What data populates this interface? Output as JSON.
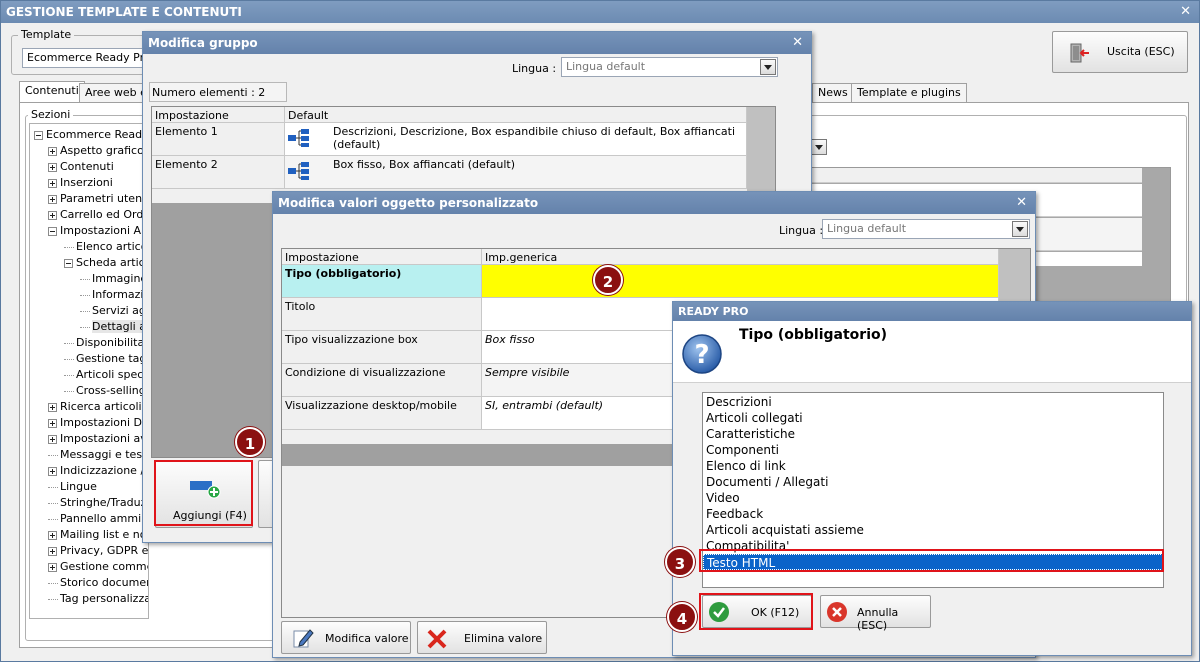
{
  "app": {
    "title": "GESTIONE TEMPLATE E CONTENUTI",
    "template_label": "Template",
    "template_value": "Ecommerce Ready Pro (",
    "exit_label": "Uscita (ESC)",
    "tabs": [
      "Contenuti",
      "Aree web e",
      "News",
      "Template e plugins"
    ],
    "sections_label": "Sezioni",
    "tree": [
      {
        "label": "Ecommerce Ready P",
        "level": 0,
        "box": "minus"
      },
      {
        "label": "Aspetto grafico",
        "level": 1,
        "box": "plus"
      },
      {
        "label": "Contenuti",
        "level": 1,
        "box": "plus"
      },
      {
        "label": "Inserzioni",
        "level": 1,
        "box": "plus"
      },
      {
        "label": "Parametri utente",
        "level": 1,
        "box": "plus"
      },
      {
        "label": "Carrello ed Ordin",
        "level": 1,
        "box": "plus"
      },
      {
        "label": "Impostazioni Arti",
        "level": 1,
        "box": "minus"
      },
      {
        "label": "Elenco articol",
        "level": 2,
        "box": ""
      },
      {
        "label": "Scheda artico",
        "level": 2,
        "box": "minus"
      },
      {
        "label": "Immagine",
        "level": 3,
        "box": ""
      },
      {
        "label": "Informazio",
        "level": 3,
        "box": ""
      },
      {
        "label": "Servizi agg",
        "level": 3,
        "box": ""
      },
      {
        "label": "Dettagli ar",
        "level": 3,
        "box": "",
        "selected": true
      },
      {
        "label": "Disponibilita' e",
        "level": 2,
        "box": ""
      },
      {
        "label": "Gestione tagli",
        "level": 2,
        "box": ""
      },
      {
        "label": "Articoli specia",
        "level": 2,
        "box": ""
      },
      {
        "label": "Cross-selling",
        "level": 2,
        "box": ""
      },
      {
        "label": "Ricerca articoli",
        "level": 1,
        "box": "plus"
      },
      {
        "label": "Impostazioni Doc",
        "level": 1,
        "box": "plus"
      },
      {
        "label": "Impostazioni ava",
        "level": 1,
        "box": "plus"
      },
      {
        "label": "Messaggi e testi",
        "level": 1,
        "box": ""
      },
      {
        "label": "Indicizzazione / S",
        "level": 1,
        "box": "plus"
      },
      {
        "label": "Lingue",
        "level": 1,
        "box": ""
      },
      {
        "label": "Stringhe/Traduzi",
        "level": 1,
        "box": ""
      },
      {
        "label": "Pannello amminis",
        "level": 1,
        "box": ""
      },
      {
        "label": "Mailing list e noti",
        "level": 1,
        "box": "plus"
      },
      {
        "label": "Privacy, GDPR e Cookie",
        "level": 1,
        "box": "plus"
      },
      {
        "label": "Gestione commenti",
        "level": 1,
        "box": "plus"
      },
      {
        "label": "Storico documenti",
        "level": 1,
        "box": ""
      },
      {
        "label": "Tag personalizzati",
        "level": 1,
        "box": ""
      }
    ]
  },
  "group_dialog": {
    "title": "Modifica gruppo",
    "lingua_label": "Lingua :",
    "lingua_value": "Lingua default",
    "count_text": "Numero elementi : 2",
    "col_setting": "Impostazione",
    "col_default": "Default",
    "rows": [
      {
        "name": "Elemento 1",
        "value": "Descrizioni, Descrizione, Box espandibile chiuso di default, Box affiancati (default)"
      },
      {
        "name": "Elemento 2",
        "value": "Box fisso, Box affiancati (default)"
      }
    ],
    "add_button": "Aggiungi (F4)"
  },
  "values_dialog": {
    "title": "Modifica valori oggetto personalizzato",
    "lingua_label": "Lingua :",
    "lingua_value": "Lingua default",
    "col_setting": "Impostazione",
    "col_generic": "Imp.generica",
    "rows": [
      {
        "name": "Tipo (obbligatorio)",
        "value": ""
      },
      {
        "name": "Titolo",
        "value": ""
      },
      {
        "name": "Tipo visualizzazione box",
        "value": "Box fisso"
      },
      {
        "name": "Condizione di visualizzazione",
        "value": "Sempre visibile"
      },
      {
        "name": "Visualizzazione desktop/mobile",
        "value": "SI, entrambi (default)"
      }
    ],
    "edit_button": "Modifica valore",
    "delete_button": "Elimina valore"
  },
  "ready_dialog": {
    "title": "READY PRO",
    "question": "Tipo (obbligatorio)",
    "options": [
      "Descrizioni",
      "Articoli collegati",
      "Caratteristiche",
      "Componenti",
      "Elenco di link",
      "Documenti / Allegati",
      "Video",
      "Feedback",
      "Articoli acquistati assieme",
      "Compatibilita'",
      "Testo HTML"
    ],
    "selected_option": "Testo HTML",
    "ok_button": "OK (F12)",
    "cancel_button": "Annulla (ESC)"
  },
  "callouts": [
    "1",
    "2",
    "3",
    "4"
  ],
  "colors": {
    "titlebar": "#7693b9",
    "selection": "#0b63c9",
    "highlight_yellow": "#ffff00",
    "highlight_cyan": "#b8f0f0",
    "callout": "#8b1010",
    "annotation_red": "#e0141a"
  }
}
